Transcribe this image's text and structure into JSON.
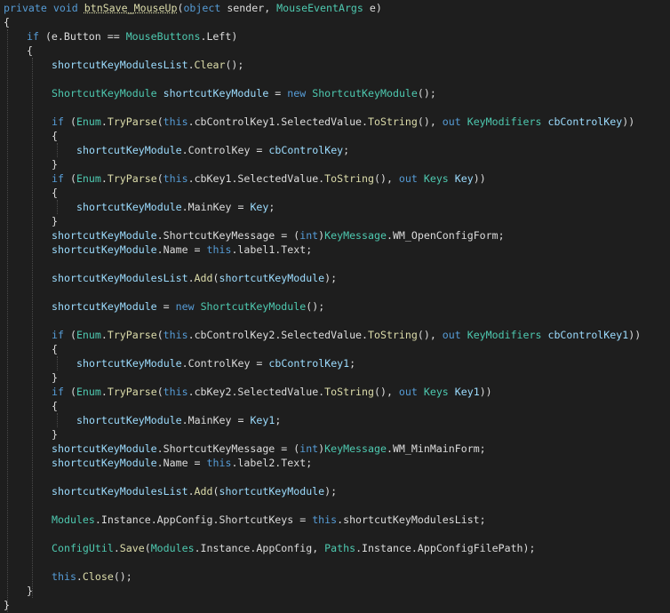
{
  "editor": {
    "language": "C#",
    "colors": {
      "background": "#1e1e1e",
      "keyword": "#569cd6",
      "type": "#4ec9b0",
      "method": "#dcdcaa",
      "variable": "#9cdcfe",
      "plain": "#dcdcdc"
    },
    "lines": [
      {
        "indent": 0,
        "tokens": [
          [
            "private",
            "kw"
          ],
          [
            " ",
            "pl"
          ],
          [
            "void",
            "kw"
          ],
          [
            " ",
            "pl"
          ],
          [
            "btnSave_MouseUp",
            "fn"
          ],
          [
            "(",
            "pl"
          ],
          [
            "object",
            "kw"
          ],
          [
            " sender, ",
            "pl"
          ],
          [
            "MouseEventArgs",
            "ty"
          ],
          [
            " e)",
            "pl"
          ]
        ]
      },
      {
        "indent": 0,
        "tokens": [
          [
            "{",
            "pl"
          ]
        ]
      },
      {
        "indent": 1,
        "tokens": [
          [
            "if",
            "kw"
          ],
          [
            " (e.Button == ",
            "pl"
          ],
          [
            "MouseButtons",
            "ty"
          ],
          [
            ".Left)",
            "pl"
          ]
        ]
      },
      {
        "indent": 1,
        "tokens": [
          [
            "{",
            "pl"
          ]
        ]
      },
      {
        "indent": 2,
        "tokens": [
          [
            "shortcutKeyModulesList",
            "va"
          ],
          [
            ".",
            "pl"
          ],
          [
            "Clear",
            "fn"
          ],
          [
            "();",
            "pl"
          ]
        ]
      },
      {
        "indent": 0,
        "tokens": []
      },
      {
        "indent": 2,
        "tokens": [
          [
            "ShortcutKeyModule",
            "ty"
          ],
          [
            " ",
            "pl"
          ],
          [
            "shortcutKeyModule",
            "va"
          ],
          [
            " = ",
            "pl"
          ],
          [
            "new",
            "kw"
          ],
          [
            " ",
            "pl"
          ],
          [
            "ShortcutKeyModule",
            "ty"
          ],
          [
            "();",
            "pl"
          ]
        ]
      },
      {
        "indent": 0,
        "tokens": []
      },
      {
        "indent": 2,
        "tokens": [
          [
            "if",
            "kw"
          ],
          [
            " (",
            "pl"
          ],
          [
            "Enum",
            "ty"
          ],
          [
            ".",
            "pl"
          ],
          [
            "TryParse",
            "fn"
          ],
          [
            "(",
            "pl"
          ],
          [
            "this",
            "kw"
          ],
          [
            ".cbControlKey1.SelectedValue.",
            "pl"
          ],
          [
            "ToString",
            "fn"
          ],
          [
            "(), ",
            "pl"
          ],
          [
            "out",
            "kw"
          ],
          [
            " ",
            "pl"
          ],
          [
            "KeyModifiers",
            "ty"
          ],
          [
            " ",
            "pl"
          ],
          [
            "cbControlKey",
            "va"
          ],
          [
            "))",
            "pl"
          ]
        ]
      },
      {
        "indent": 2,
        "tokens": [
          [
            "{",
            "pl"
          ]
        ]
      },
      {
        "indent": 3,
        "tokens": [
          [
            "shortcutKeyModule",
            "va"
          ],
          [
            ".ControlKey = ",
            "pl"
          ],
          [
            "cbControlKey",
            "va"
          ],
          [
            ";",
            "pl"
          ]
        ]
      },
      {
        "indent": 2,
        "tokens": [
          [
            "}",
            "pl"
          ]
        ]
      },
      {
        "indent": 2,
        "tokens": [
          [
            "if",
            "kw"
          ],
          [
            " (",
            "pl"
          ],
          [
            "Enum",
            "ty"
          ],
          [
            ".",
            "pl"
          ],
          [
            "TryParse",
            "fn"
          ],
          [
            "(",
            "pl"
          ],
          [
            "this",
            "kw"
          ],
          [
            ".cbKey1.SelectedValue.",
            "pl"
          ],
          [
            "ToString",
            "fn"
          ],
          [
            "(), ",
            "pl"
          ],
          [
            "out",
            "kw"
          ],
          [
            " ",
            "pl"
          ],
          [
            "Keys",
            "ty"
          ],
          [
            " ",
            "pl"
          ],
          [
            "Key",
            "va"
          ],
          [
            "))",
            "pl"
          ]
        ]
      },
      {
        "indent": 2,
        "tokens": [
          [
            "{",
            "pl"
          ]
        ]
      },
      {
        "indent": 3,
        "tokens": [
          [
            "shortcutKeyModule",
            "va"
          ],
          [
            ".MainKey = ",
            "pl"
          ],
          [
            "Key",
            "va"
          ],
          [
            ";",
            "pl"
          ]
        ]
      },
      {
        "indent": 2,
        "tokens": [
          [
            "}",
            "pl"
          ]
        ]
      },
      {
        "indent": 2,
        "tokens": [
          [
            "shortcutKeyModule",
            "va"
          ],
          [
            ".ShortcutKeyMessage = (",
            "pl"
          ],
          [
            "int",
            "kw"
          ],
          [
            ")",
            "pl"
          ],
          [
            "KeyMessage",
            "ty"
          ],
          [
            ".WM_OpenConfigForm;",
            "pl"
          ]
        ]
      },
      {
        "indent": 2,
        "tokens": [
          [
            "shortcutKeyModule",
            "va"
          ],
          [
            ".Name = ",
            "pl"
          ],
          [
            "this",
            "kw"
          ],
          [
            ".label1.Text;",
            "pl"
          ]
        ]
      },
      {
        "indent": 0,
        "tokens": []
      },
      {
        "indent": 2,
        "tokens": [
          [
            "shortcutKeyModulesList",
            "va"
          ],
          [
            ".",
            "pl"
          ],
          [
            "Add",
            "fn"
          ],
          [
            "(",
            "pl"
          ],
          [
            "shortcutKeyModule",
            "va"
          ],
          [
            ");",
            "pl"
          ]
        ]
      },
      {
        "indent": 0,
        "tokens": []
      },
      {
        "indent": 2,
        "tokens": [
          [
            "shortcutKeyModule",
            "va"
          ],
          [
            " = ",
            "pl"
          ],
          [
            "new",
            "kw"
          ],
          [
            " ",
            "pl"
          ],
          [
            "ShortcutKeyModule",
            "ty"
          ],
          [
            "();",
            "pl"
          ]
        ]
      },
      {
        "indent": 0,
        "tokens": []
      },
      {
        "indent": 2,
        "tokens": [
          [
            "if",
            "kw"
          ],
          [
            " (",
            "pl"
          ],
          [
            "Enum",
            "ty"
          ],
          [
            ".",
            "pl"
          ],
          [
            "TryParse",
            "fn"
          ],
          [
            "(",
            "pl"
          ],
          [
            "this",
            "kw"
          ],
          [
            ".cbControlKey2.SelectedValue.",
            "pl"
          ],
          [
            "ToString",
            "fn"
          ],
          [
            "(), ",
            "pl"
          ],
          [
            "out",
            "kw"
          ],
          [
            " ",
            "pl"
          ],
          [
            "KeyModifiers",
            "ty"
          ],
          [
            " ",
            "pl"
          ],
          [
            "cbControlKey1",
            "va"
          ],
          [
            "))",
            "pl"
          ]
        ]
      },
      {
        "indent": 2,
        "tokens": [
          [
            "{",
            "pl"
          ]
        ]
      },
      {
        "indent": 3,
        "tokens": [
          [
            "shortcutKeyModule",
            "va"
          ],
          [
            ".ControlKey = ",
            "pl"
          ],
          [
            "cbControlKey1",
            "va"
          ],
          [
            ";",
            "pl"
          ]
        ]
      },
      {
        "indent": 2,
        "tokens": [
          [
            "}",
            "pl"
          ]
        ]
      },
      {
        "indent": 2,
        "tokens": [
          [
            "if",
            "kw"
          ],
          [
            " (",
            "pl"
          ],
          [
            "Enum",
            "ty"
          ],
          [
            ".",
            "pl"
          ],
          [
            "TryParse",
            "fn"
          ],
          [
            "(",
            "pl"
          ],
          [
            "this",
            "kw"
          ],
          [
            ".cbKey2.SelectedValue.",
            "pl"
          ],
          [
            "ToString",
            "fn"
          ],
          [
            "(), ",
            "pl"
          ],
          [
            "out",
            "kw"
          ],
          [
            " ",
            "pl"
          ],
          [
            "Keys",
            "ty"
          ],
          [
            " ",
            "pl"
          ],
          [
            "Key1",
            "va"
          ],
          [
            "))",
            "pl"
          ]
        ]
      },
      {
        "indent": 2,
        "tokens": [
          [
            "{",
            "pl"
          ]
        ]
      },
      {
        "indent": 3,
        "tokens": [
          [
            "shortcutKeyModule",
            "va"
          ],
          [
            ".MainKey = ",
            "pl"
          ],
          [
            "Key1",
            "va"
          ],
          [
            ";",
            "pl"
          ]
        ]
      },
      {
        "indent": 2,
        "tokens": [
          [
            "}",
            "pl"
          ]
        ]
      },
      {
        "indent": 2,
        "tokens": [
          [
            "shortcutKeyModule",
            "va"
          ],
          [
            ".ShortcutKeyMessage = (",
            "pl"
          ],
          [
            "int",
            "kw"
          ],
          [
            ")",
            "pl"
          ],
          [
            "KeyMessage",
            "ty"
          ],
          [
            ".WM_MinMainForm;",
            "pl"
          ]
        ]
      },
      {
        "indent": 2,
        "tokens": [
          [
            "shortcutKeyModule",
            "va"
          ],
          [
            ".Name = ",
            "pl"
          ],
          [
            "this",
            "kw"
          ],
          [
            ".label2.Text;",
            "pl"
          ]
        ]
      },
      {
        "indent": 0,
        "tokens": []
      },
      {
        "indent": 2,
        "tokens": [
          [
            "shortcutKeyModulesList",
            "va"
          ],
          [
            ".",
            "pl"
          ],
          [
            "Add",
            "fn"
          ],
          [
            "(",
            "pl"
          ],
          [
            "shortcutKeyModule",
            "va"
          ],
          [
            ");",
            "pl"
          ]
        ]
      },
      {
        "indent": 0,
        "tokens": []
      },
      {
        "indent": 2,
        "tokens": [
          [
            "Modules",
            "ty"
          ],
          [
            ".Instance.AppConfig.ShortcutKeys = ",
            "pl"
          ],
          [
            "this",
            "kw"
          ],
          [
            ".shortcutKeyModulesList;",
            "pl"
          ]
        ]
      },
      {
        "indent": 0,
        "tokens": []
      },
      {
        "indent": 2,
        "tokens": [
          [
            "ConfigUtil",
            "ty"
          ],
          [
            ".",
            "pl"
          ],
          [
            "Save",
            "fn"
          ],
          [
            "(",
            "pl"
          ],
          [
            "Modules",
            "ty"
          ],
          [
            ".Instance.AppConfig, ",
            "pl"
          ],
          [
            "Paths",
            "ty"
          ],
          [
            ".Instance.AppConfigFilePath);",
            "pl"
          ]
        ]
      },
      {
        "indent": 0,
        "tokens": []
      },
      {
        "indent": 2,
        "tokens": [
          [
            "this",
            "kw"
          ],
          [
            ".",
            "pl"
          ],
          [
            "Close",
            "fn"
          ],
          [
            "();",
            "pl"
          ]
        ]
      },
      {
        "indent": 1,
        "tokens": [
          [
            "}",
            "pl"
          ]
        ]
      },
      {
        "indent": 0,
        "tokens": [
          [
            "}",
            "pl"
          ]
        ]
      }
    ]
  }
}
